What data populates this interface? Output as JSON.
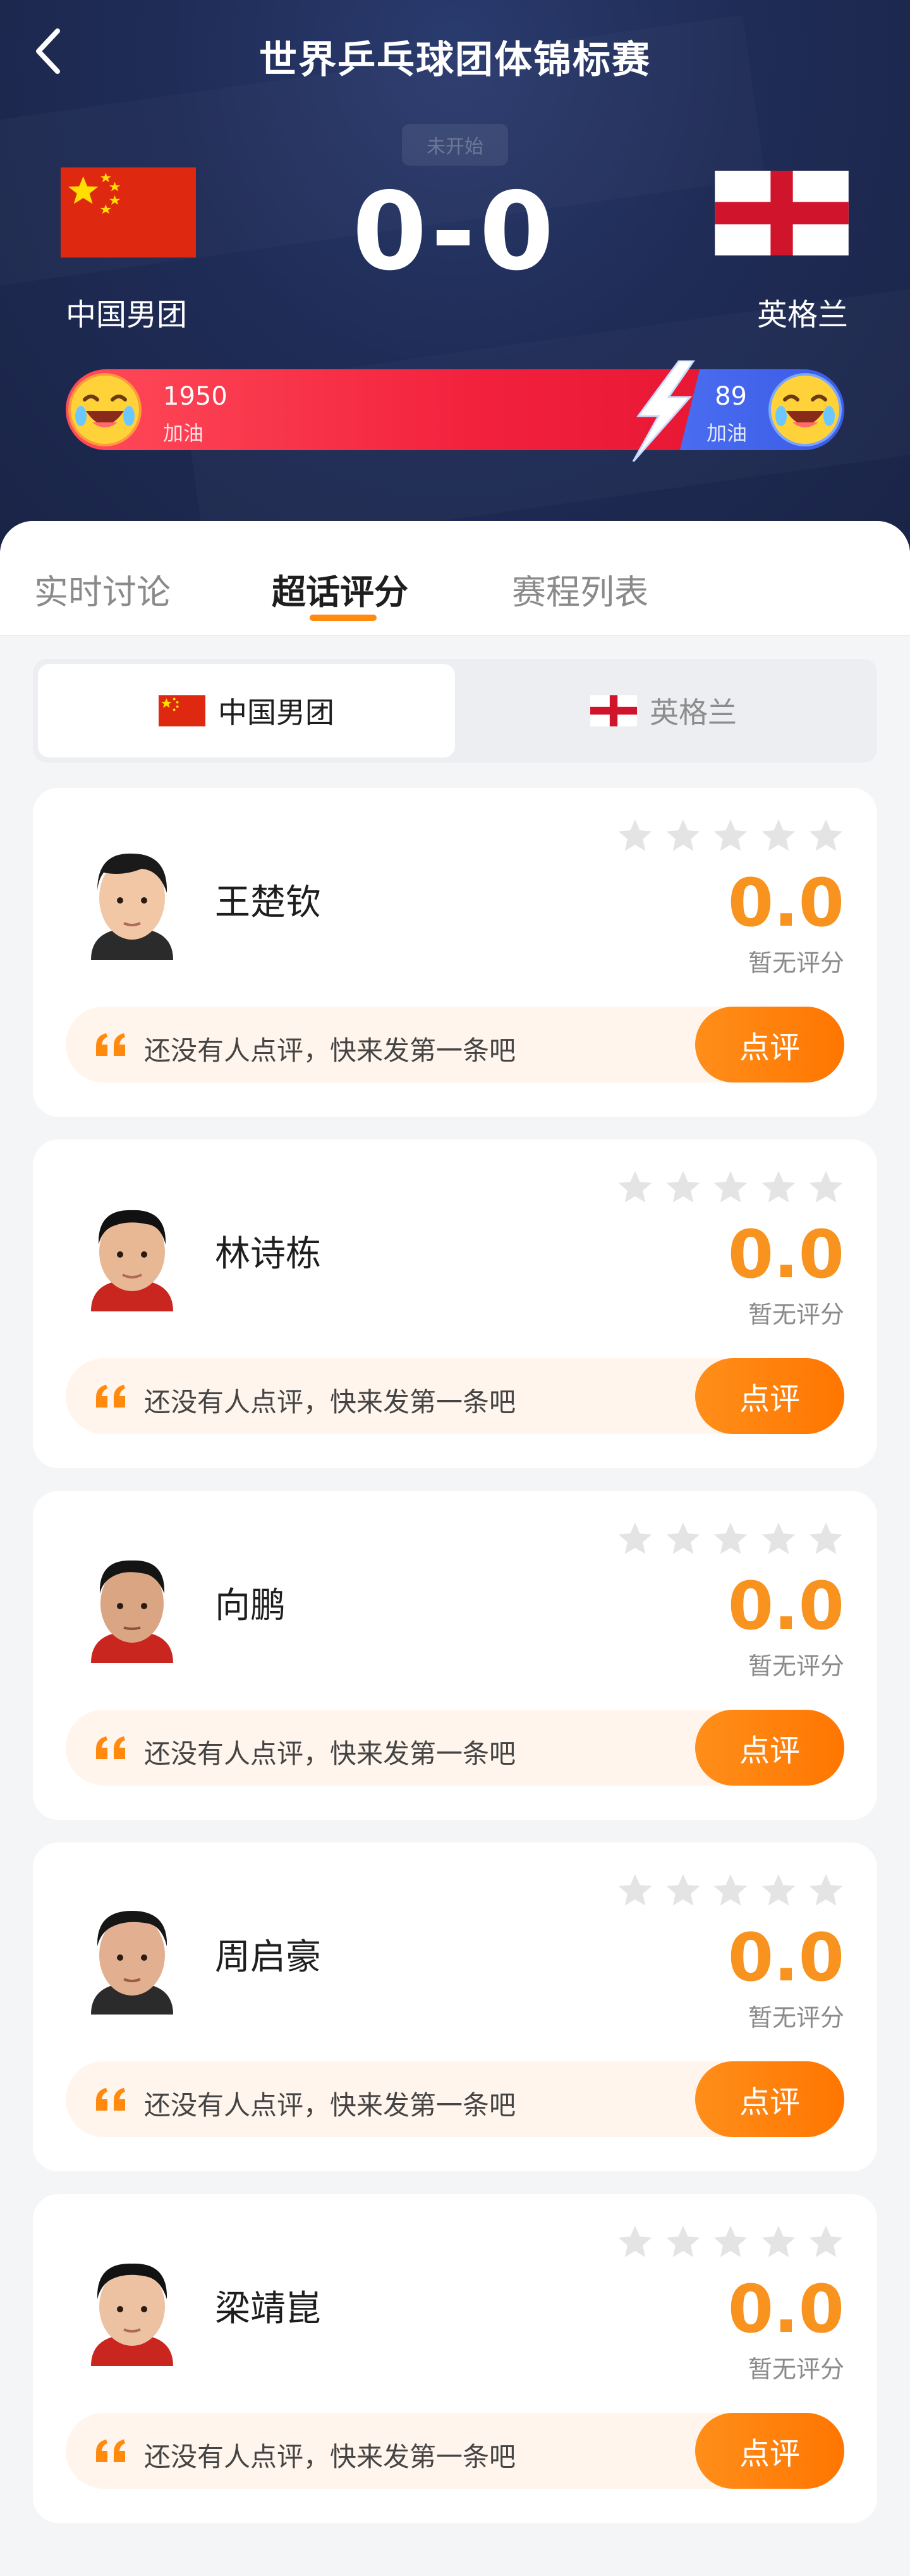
{
  "header": {
    "title": "世界乒乓球团体锦标赛",
    "back_icon": "chevron-left-icon",
    "status": "未开始",
    "score": "0-0",
    "home_team": "中国男团",
    "away_team": "英格兰",
    "home_cheer_count": "1950",
    "away_cheer_count": "89",
    "cheer_label": "加油",
    "colors": {
      "header_bg": "#1f2c56",
      "home_bar": "#f2203c",
      "away_bar": "#3a5ce6"
    }
  },
  "tabs": [
    {
      "label": "实时讨论",
      "active": false
    },
    {
      "label": "超话评分",
      "active": true
    },
    {
      "label": "赛程列表",
      "active": false
    }
  ],
  "team_switch": [
    {
      "label": "中国男团",
      "active": true
    },
    {
      "label": "英格兰",
      "active": false
    }
  ],
  "players": [
    {
      "name": "王楚钦",
      "score": "0.0",
      "rating": 0,
      "score_note": "暂无评分",
      "review_placeholder": "还没有人点评，快来发第一条吧",
      "button": "点评"
    },
    {
      "name": "林诗栋",
      "score": "0.0",
      "rating": 0,
      "score_note": "暂无评分",
      "review_placeholder": "还没有人点评，快来发第一条吧",
      "button": "点评"
    },
    {
      "name": "向鹏",
      "score": "0.0",
      "rating": 0,
      "score_note": "暂无评分",
      "review_placeholder": "还没有人点评，快来发第一条吧",
      "button": "点评"
    },
    {
      "name": "周启豪",
      "score": "0.0",
      "rating": 0,
      "score_note": "暂无评分",
      "review_placeholder": "还没有人点评，快来发第一条吧",
      "button": "点评"
    },
    {
      "name": "梁靖崑",
      "score": "0.0",
      "rating": 0,
      "score_note": "暂无评分",
      "review_placeholder": "还没有人点评，快来发第一条吧",
      "button": "点评"
    }
  ],
  "accent_color": "#ff7f0a"
}
